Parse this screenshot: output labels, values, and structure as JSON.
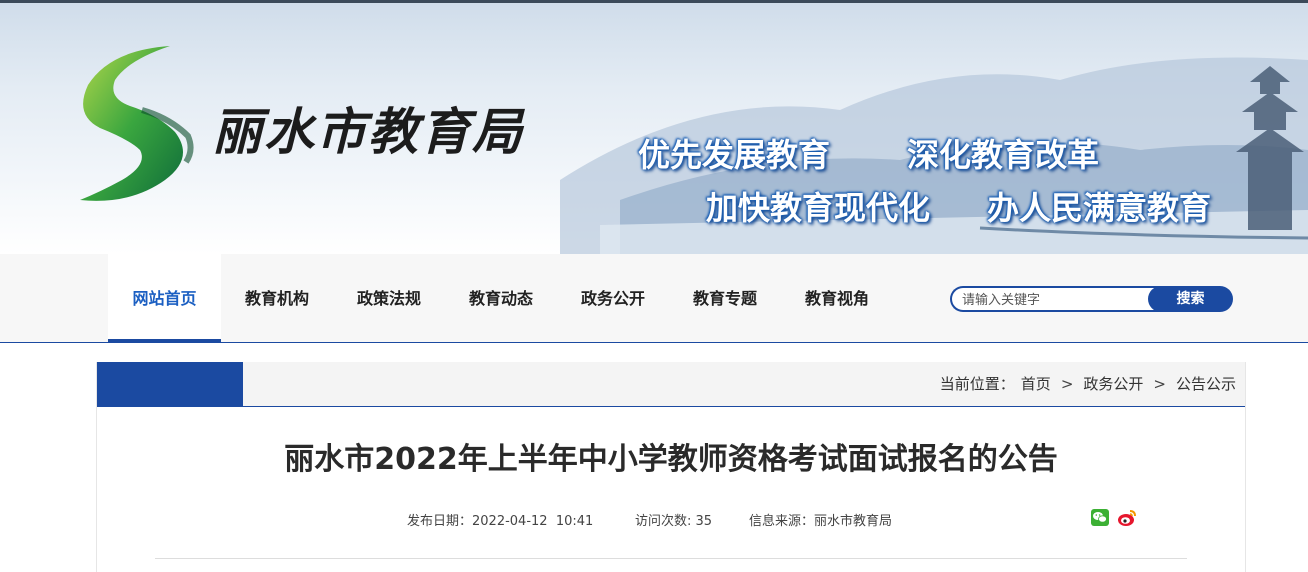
{
  "header": {
    "site_name": "丽水市教育局",
    "slogans": [
      "优先发展教育",
      "深化教育改革",
      "加快教育现代化",
      "办人民满意教育"
    ]
  },
  "nav": {
    "items": [
      {
        "label": "网站首页",
        "active": true
      },
      {
        "label": "教育机构"
      },
      {
        "label": "政策法规"
      },
      {
        "label": "教育动态"
      },
      {
        "label": "政务公开"
      },
      {
        "label": "教育专题"
      },
      {
        "label": "教育视角"
      }
    ],
    "search": {
      "placeholder": "请输入关键字",
      "button": "搜索"
    }
  },
  "breadcrumb": {
    "prefix": "当前位置：",
    "items": [
      "首页",
      "政务公开",
      "公告公示"
    ],
    "separator": ">"
  },
  "article": {
    "title": "丽水市2022年上半年中小学教师资格考试面试报名的公告",
    "publish_label": "发布日期：",
    "publish_date": "2022-04-12  10:41",
    "visits_label": "访问次数:",
    "visits": "35",
    "source_label": "信息来源：",
    "source": "丽水市教育局"
  },
  "share": {
    "icons": [
      "wechat-icon",
      "weibo-icon"
    ]
  },
  "colors": {
    "accent": "#1b4aa1",
    "active_nav_text": "#1b5fc2",
    "wechat": "#3cb034",
    "weibo": "#e6162d"
  }
}
